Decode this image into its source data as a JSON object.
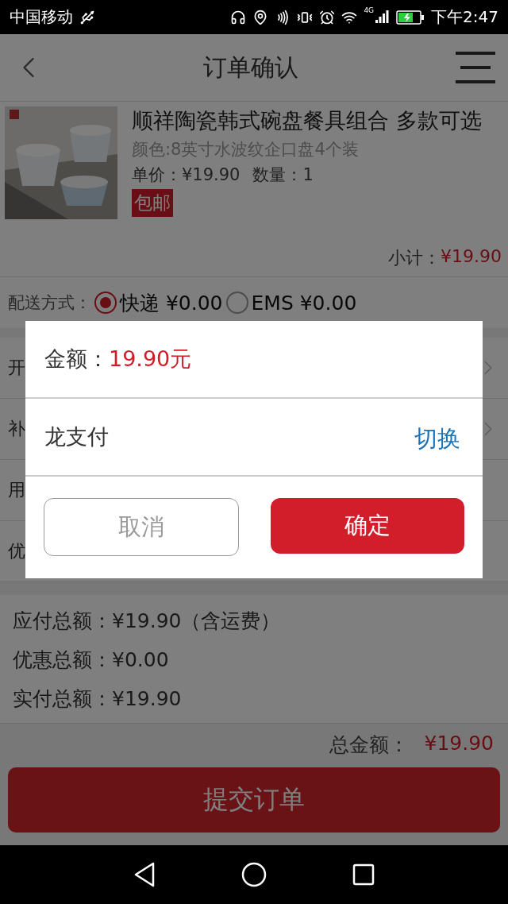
{
  "status_bar": {
    "carrier": "中国移动",
    "network": "4G",
    "time": "下午2:47"
  },
  "header": {
    "title": "订单确认"
  },
  "product": {
    "name": "顺祥陶瓷韩式碗盘餐具组合 多款可选",
    "variant": "颜色:8英寸水波纹企口盘4个装",
    "unit_price": "单价：¥19.90",
    "quantity": "数量：1",
    "tag": "包邮",
    "subtotal_label": "小计：",
    "subtotal": "¥19.90"
  },
  "shipping": {
    "label": "配送方式：",
    "options": [
      {
        "label": "快递 ¥0.00",
        "selected": true
      },
      {
        "label": "EMS ¥0.00",
        "selected": false
      }
    ]
  },
  "option_rows": [
    {
      "label": "开",
      "arrow": true
    },
    {
      "label": "补",
      "arrow": true
    },
    {
      "label": "用",
      "arrow": false
    },
    {
      "label": "优",
      "arrow": false
    }
  ],
  "totals": [
    {
      "label": "应付总额：",
      "value": "¥19.90（含运费）"
    },
    {
      "label": "优惠总额：",
      "value": "¥0.00"
    },
    {
      "label": "实付总额：",
      "value": "¥19.90"
    }
  ],
  "summary": {
    "label": "总金额：",
    "value": "¥19.90"
  },
  "submit": "提交订单",
  "dialog": {
    "amount_label": "金额：",
    "amount": "19.90元",
    "method": "龙支付",
    "switch": "切换",
    "cancel": "取消",
    "confirm": "确定"
  }
}
